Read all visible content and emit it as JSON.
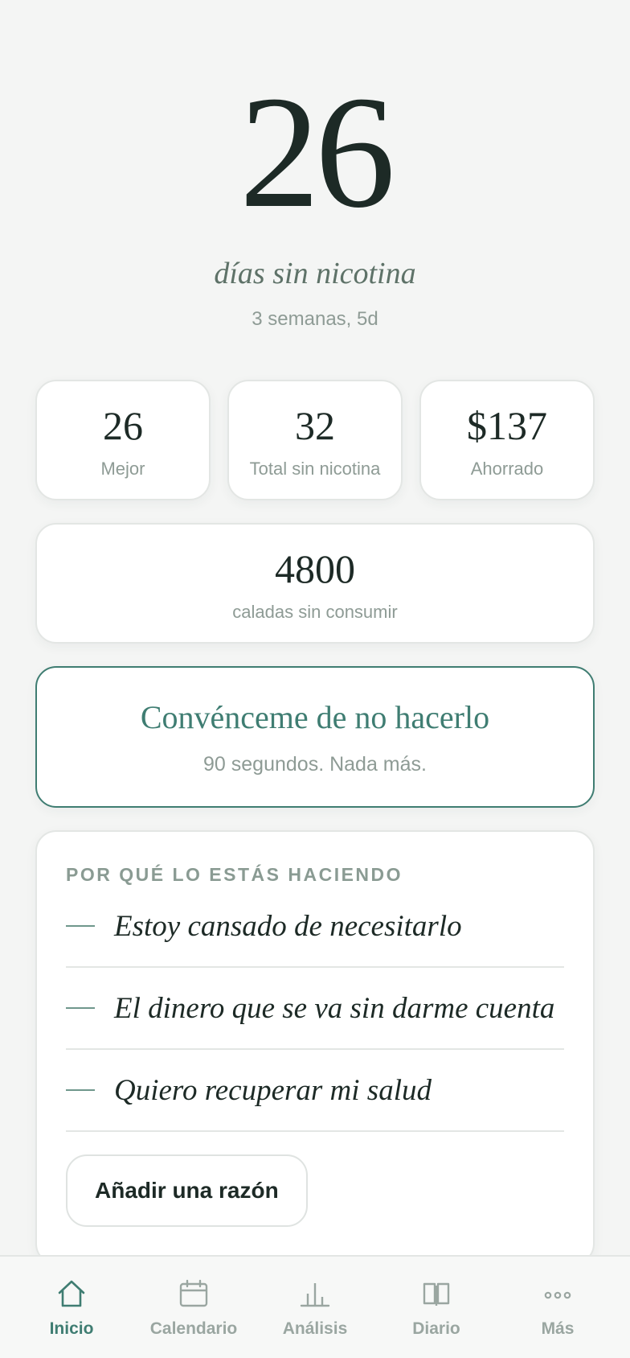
{
  "hero": {
    "days": "26",
    "subtitle": "días sin nicotina",
    "detail": "3 semanas, 5d"
  },
  "stats": [
    {
      "value": "26",
      "label": "Mejor"
    },
    {
      "value": "32",
      "label": "Total sin nicotina"
    },
    {
      "value": "$137",
      "label": "Ahorrado"
    }
  ],
  "puffs": {
    "value": "4800",
    "label": "caladas sin consumir"
  },
  "convince": {
    "title": "Convénceme de no hacerlo",
    "subtitle": "90 segundos. Nada más."
  },
  "reasons": {
    "title": "POR QUÉ LO ESTÁS HACIENDO",
    "items": [
      "Estoy cansado de necesitarlo",
      "El dinero que se va sin darme cuenta",
      "Quiero recuperar mi salud"
    ],
    "add_label": "Añadir una razón"
  },
  "tabs": [
    {
      "label": "Inicio",
      "icon": "home-icon",
      "active": true
    },
    {
      "label": "Calendario",
      "icon": "calendar-icon",
      "active": false
    },
    {
      "label": "Análisis",
      "icon": "bar-chart-icon",
      "active": false
    },
    {
      "label": "Diario",
      "icon": "book-icon",
      "active": false
    },
    {
      "label": "Más",
      "icon": "more-icon",
      "active": false
    }
  ],
  "colors": {
    "accent": "#3f7d72",
    "background": "#f4f5f4",
    "text": "#1d2a26",
    "muted": "#8e9b95"
  }
}
